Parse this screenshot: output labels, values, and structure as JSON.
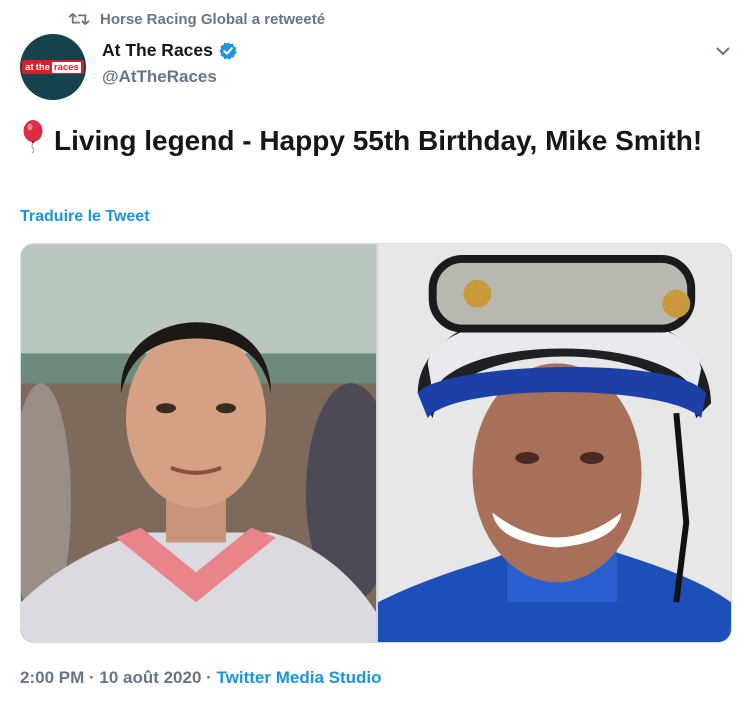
{
  "retweet": {
    "label": "Horse Racing Global a retweeté"
  },
  "author": {
    "avatar_logo": {
      "part1": "at",
      "part2": "the",
      "part3": "races"
    },
    "name": "At The Races",
    "handle": "@AtTheRaces"
  },
  "tweet": {
    "text": "Living legend - Happy 55th Birthday, Mike Smith!",
    "translate_label": "Traduire le Tweet"
  },
  "media": {
    "left_photo_alt": "young jockey portrait",
    "right_photo_alt": "jockey in helmet and goggles smiling"
  },
  "meta": {
    "time": "2:00 PM",
    "separator1": " · ",
    "date": "10 août 2020",
    "separator2": " · ",
    "source": "Twitter Media Studio"
  },
  "colors": {
    "link": "#1b95e0",
    "muted": "#657786",
    "text": "#14171a",
    "brand_red": "#d81f2a"
  }
}
